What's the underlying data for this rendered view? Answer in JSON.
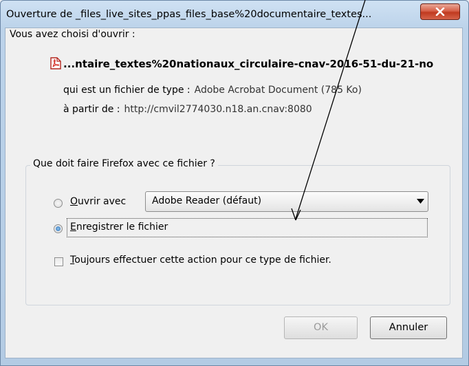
{
  "window": {
    "title": "Ouverture de _files_live_sites_ppas_files_base%20documentaire_textes...",
    "close_icon": "close-icon"
  },
  "intro": "Vous avez choisi d'ouvrir :",
  "file": {
    "icon": "pdf-icon",
    "name": "...ntaire_textes%20nationaux_circulaire-cnav-2016-51-du-21-no",
    "type_label": "qui est un fichier de type :",
    "type_value": "Adobe Acrobat Document (785 Ko)",
    "from_label": "à partir de :",
    "from_value": "http://cmvil2774030.n18.an.cnav:8080"
  },
  "action_group": {
    "title": "Que doit faire Firefox avec ce fichier ?",
    "open_with_prefix": "O",
    "open_with_rest": "uvrir avec",
    "open_with_app": "Adobe Reader  (défaut)",
    "save_prefix": "E",
    "save_rest": "nregistrer le fichier",
    "selected": "save",
    "always_prefix": "T",
    "always_rest": "oujours effectuer cette action pour ce type de fichier.",
    "always_checked": false
  },
  "buttons": {
    "ok": "OK",
    "cancel": "Annuler"
  },
  "colors": {
    "accent": "#2b6eb7",
    "close": "#c0391f"
  }
}
